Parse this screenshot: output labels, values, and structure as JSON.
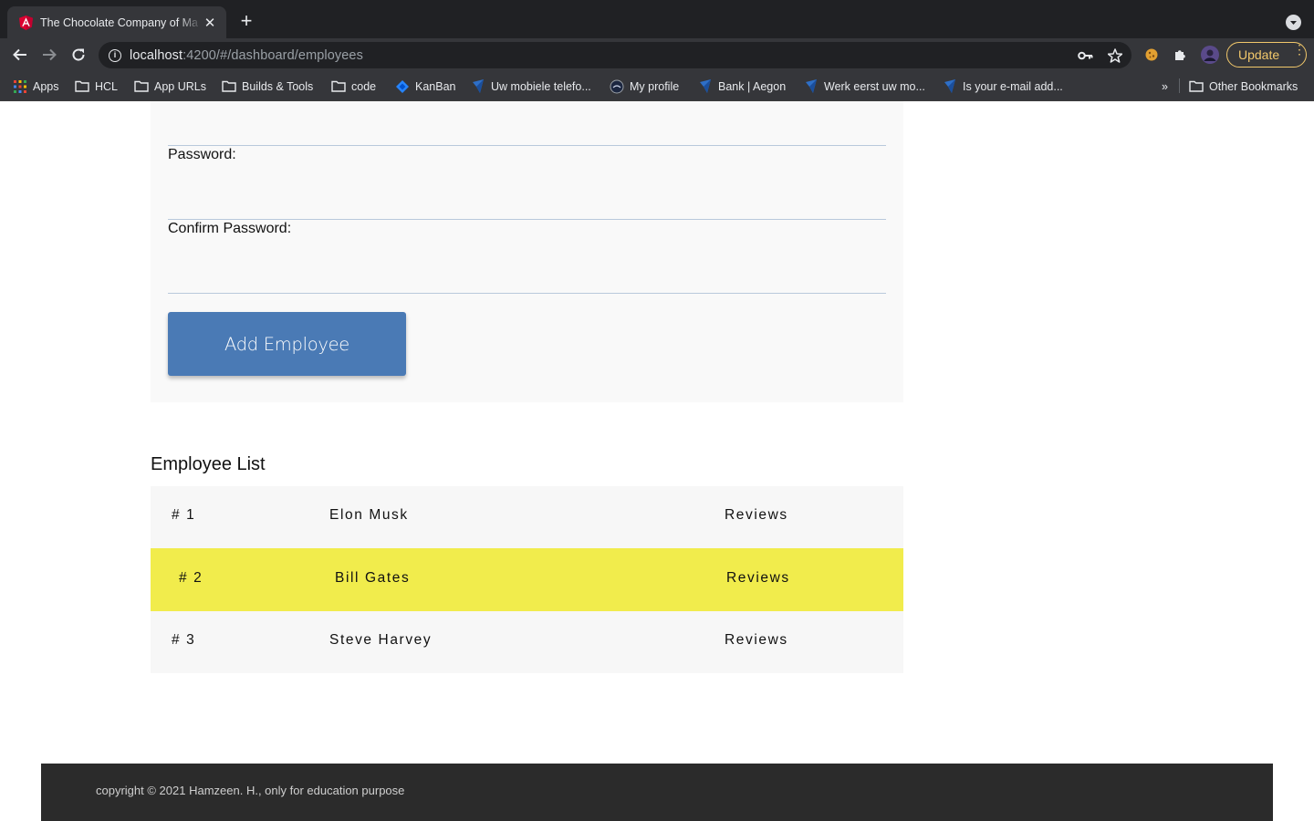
{
  "browser": {
    "tab_title": "The Chocolate Company of Ma",
    "tab_favicon": "angular-icon",
    "url_host": "localhost",
    "url_rest": ":4200/#/dashboard/employees",
    "update_label": "Update",
    "bookmarks": [
      {
        "label": "Apps",
        "icon": "apps-grid-icon"
      },
      {
        "label": "HCL",
        "icon": "folder-icon"
      },
      {
        "label": "App URLs",
        "icon": "folder-icon"
      },
      {
        "label": "Builds & Tools",
        "icon": "folder-icon"
      },
      {
        "label": "code",
        "icon": "folder-icon"
      },
      {
        "label": "KanBan",
        "icon": "jira-icon"
      },
      {
        "label": "Uw mobiele telefo...",
        "icon": "bookmark-site-icon"
      },
      {
        "label": "My profile",
        "icon": "profile-site-icon"
      },
      {
        "label": "Bank | Aegon",
        "icon": "bookmark-site-icon"
      },
      {
        "label": "Werk eerst uw mo...",
        "icon": "bookmark-site-icon"
      },
      {
        "label": "Is your e-mail add...",
        "icon": "bookmark-site-icon"
      }
    ],
    "overflow_label": "»",
    "other_bookmarks": "Other Bookmarks"
  },
  "form": {
    "password_label": "Password:",
    "confirm_password_label": "Confirm Password:",
    "add_button_label": "Add Employee"
  },
  "employee_list": {
    "title": "Employee List",
    "rows": [
      {
        "number": "# 1",
        "name": "Elon Musk",
        "action": "Reviews",
        "highlighted": false
      },
      {
        "number": "# 2",
        "name": "Bill Gates",
        "action": "Reviews",
        "highlighted": true
      },
      {
        "number": "# 3",
        "name": "Steve Harvey",
        "action": "Reviews",
        "highlighted": false
      }
    ]
  },
  "footer": {
    "text": "copyright © 2021 Hamzeen. H., only for education purpose"
  },
  "colors": {
    "button_blue": "#4a7ab5",
    "highlight_yellow": "#f1ec4c",
    "footer_bg": "#2b2b2b",
    "update_accent": "#f2c86b"
  }
}
